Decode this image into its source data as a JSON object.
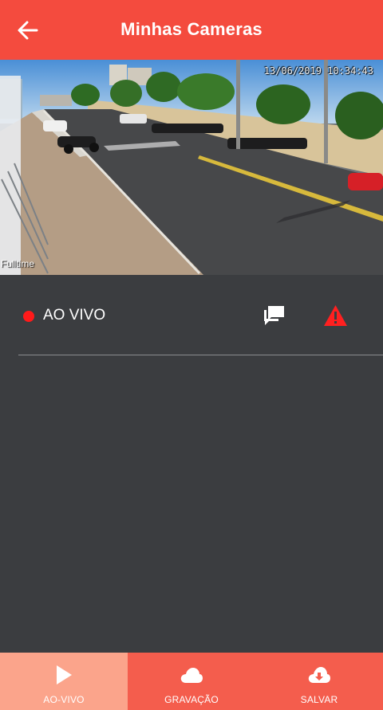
{
  "header": {
    "title": "Minhas Cameras",
    "back_icon": "arrow-left-icon"
  },
  "video": {
    "timestamp": "13/06/2019 10:34:43",
    "watermark": "Fulltime"
  },
  "status": {
    "live_label": "AO VIVO",
    "live_dot_color": "#ff1a1a",
    "chat_icon": "chat-bubbles-icon",
    "alert_icon": "warning-triangle-icon",
    "alert_color": "#ff2020"
  },
  "bottom_nav": {
    "items": [
      {
        "label": "AO-VIVO",
        "icon": "play-icon",
        "active": true
      },
      {
        "label": "GRAVAÇÃO",
        "icon": "cloud-icon",
        "active": false
      },
      {
        "label": "SALVAR",
        "icon": "cloud-download-icon",
        "active": false
      }
    ]
  },
  "colors": {
    "appbar": "#f44b3e",
    "background": "#3b3d40",
    "nav": "#f45d4d",
    "nav_active": "#fba48b"
  }
}
